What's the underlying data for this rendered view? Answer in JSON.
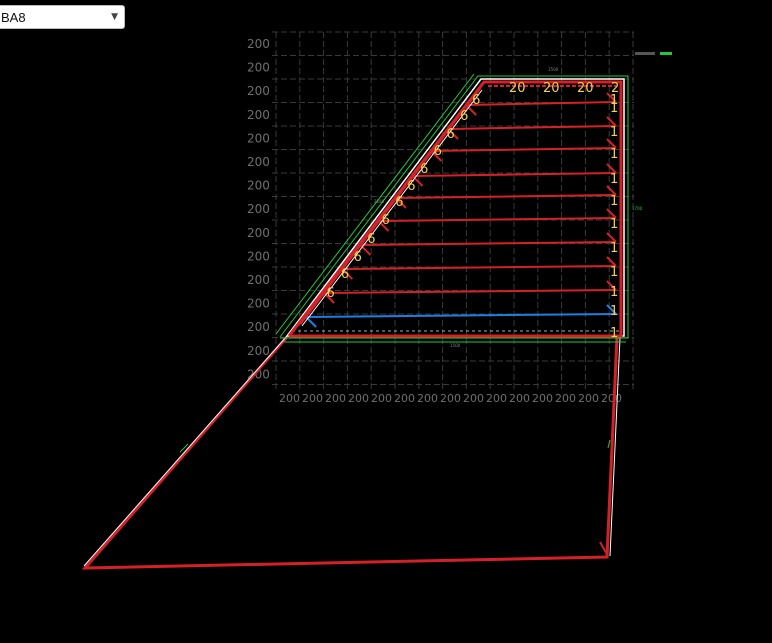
{
  "dropdown": {
    "selected": "BA8"
  },
  "grid": {
    "row_labels": [
      "200",
      "200",
      "200",
      "200",
      "200",
      "200",
      "200",
      "200",
      "200",
      "200",
      "200",
      "200",
      "200",
      "200",
      "200"
    ],
    "col_labels": [
      "200",
      "200",
      "200",
      "200",
      "200",
      "200",
      "200",
      "200",
      "200",
      "200",
      "200",
      "200",
      "200",
      "200",
      "200"
    ]
  },
  "top_labels": [
    "20",
    "20",
    "20",
    "2"
  ],
  "left_labels": [
    "6",
    "6",
    "6",
    "6",
    "6",
    "6",
    "6",
    "6",
    "6",
    "6",
    "6",
    "6"
  ],
  "right_labels": [
    "1",
    "1",
    "1",
    "1",
    "1",
    "1",
    "1",
    "1",
    "1",
    "1",
    "1",
    "1"
  ],
  "colors": {
    "rebar": "#d42128",
    "highlight": "#1e7fe0",
    "outline": "#ffffff",
    "dimension": "#22c93a",
    "grid": "#3a3a3a",
    "label": "#f3d04b",
    "grid_text": "#6f6f6f"
  }
}
